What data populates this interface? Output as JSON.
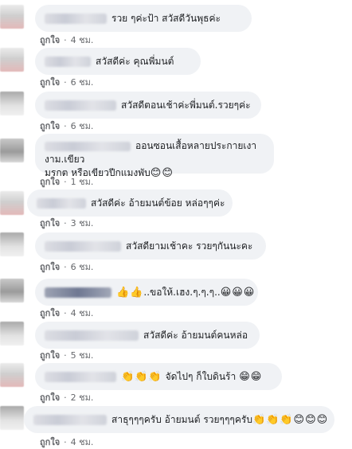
{
  "like_label": "ถูกใจ",
  "separator": "·",
  "comments": [
    {
      "text": "รวย ๆค่ะป้า สวัสดีวันพุธค่ะ",
      "emoji": "",
      "time": "4 ชม."
    },
    {
      "text": "สวัสดีค่ะ คุณพี่มนต์",
      "emoji": "",
      "time": "6 ชม."
    },
    {
      "text": "สวัสดีตอนเช้าค่ะพี่มนต์.รวยๆค่ะ",
      "emoji": "",
      "time": "6 ชม."
    },
    {
      "text": "ออนซอนเสื้อหลายประกายเงางาม.เขียว",
      "text2": "มรกต หรือเขียวปีกแมงพับ",
      "emoji": "😊😊",
      "time": "1 ชม."
    },
    {
      "text": "สวัสดีค่ะ อ้ายมนต์ข้อย หล่อๆๆค่ะ",
      "emoji": "",
      "time": "3 ชม."
    },
    {
      "text": "สวัสดียามเช้าคะ รวยๆกันนะคะ",
      "emoji": "",
      "time": "6 ชม."
    },
    {
      "text": "..ขอให้.เฮง.ๆ.ๆ.ๆ..",
      "emoji_before": "👍👍",
      "emoji": "😀😀😀",
      "time": "4 ชม."
    },
    {
      "text": "สวัสดีค่ะ อ้ายมนต์คนหล่อ",
      "emoji": "",
      "time": "5 ชม."
    },
    {
      "text": "จัดไปๆ ก็ใบดินร้า",
      "emoji_before": "👏👏👏",
      "emoji": "😁😁",
      "time": "2 ชม."
    },
    {
      "text": "สาธุๆๆๆครับ อ้ายมนต์ รวยๆๆๆครับ",
      "emoji": "👏👏👏😊😊😊",
      "time": "4 ชม."
    }
  ]
}
